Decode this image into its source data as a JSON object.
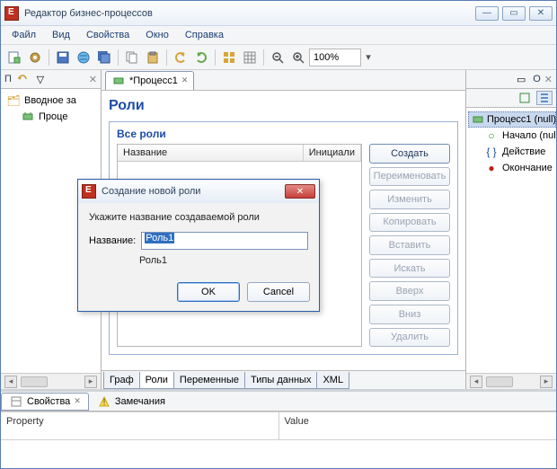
{
  "window": {
    "title": "Редактор бизнес-процессов"
  },
  "menu": [
    "Файл",
    "Вид",
    "Свойства",
    "Окно",
    "Справка"
  ],
  "toolbar": {
    "zoom": "100%"
  },
  "left_tree": {
    "root": "Вводное за",
    "child": "Проце"
  },
  "editor": {
    "tab": "*Процесс1",
    "section_title": "Роли",
    "subsection": "Все роли",
    "columns": [
      "Название",
      "Инициали"
    ],
    "buttons": [
      "Создать",
      "Переименовать",
      "Изменить",
      "Копировать",
      "Вставить",
      "Искать",
      "Вверх",
      "Вниз",
      "Удалить"
    ],
    "bottom_tabs": [
      "Граф",
      "Роли",
      "Переменные",
      "Типы данных",
      "XML"
    ]
  },
  "outline": {
    "label_o": "О",
    "root": "Процесс1 (null)",
    "items": [
      {
        "glyph": "○",
        "color": "#17a117",
        "text": "Начало (nul"
      },
      {
        "glyph": "{ }",
        "color": "#1d4ca5",
        "text": "Действие"
      },
      {
        "glyph": "●",
        "color": "#c02018",
        "text": "Окончание "
      }
    ]
  },
  "bottom": {
    "tabs": [
      "Свойства",
      "Замечания"
    ],
    "headers": [
      "Property",
      "Value"
    ]
  },
  "dialog": {
    "title": "Создание новой роли",
    "prompt": "Укажите название создаваемой роли",
    "field_label": "Название:",
    "field_value": "Роль1",
    "existing": "Роль1",
    "ok": "OK",
    "cancel": "Cancel"
  }
}
